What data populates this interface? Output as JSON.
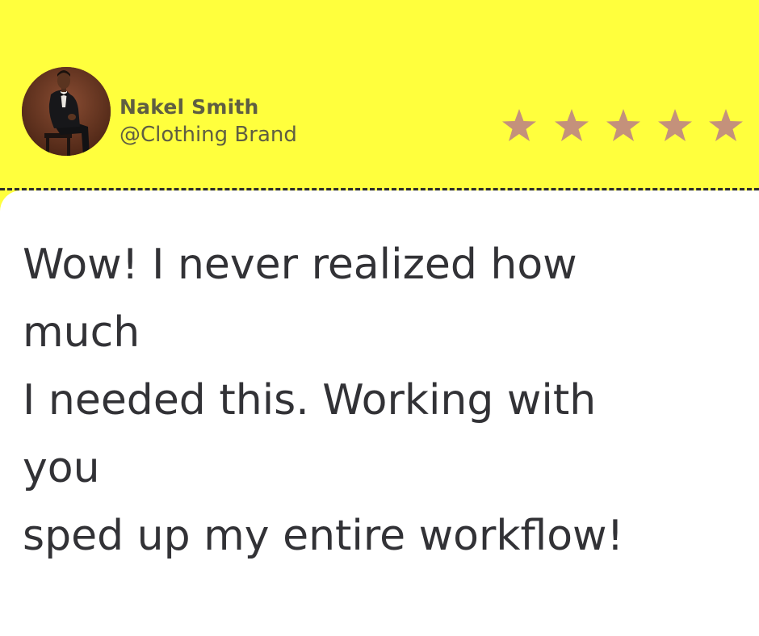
{
  "user": {
    "name": "Nakel Smith",
    "handle": "@Clothing Brand"
  },
  "rating": {
    "stars_filled": 5,
    "stars_total": 5,
    "star_color": "#c4917b"
  },
  "review": {
    "lines": [
      "Wow! I never realized how",
      "much",
      "I needed this. Working with",
      "you",
      "sped up my entire workflow!"
    ]
  },
  "colors": {
    "header_background": "#ffff3d",
    "body_background": "#ffffff",
    "text": "#323236",
    "name_text": "#5f5e42"
  },
  "icons": {
    "avatar": "person-photo",
    "star": "star-icon"
  }
}
